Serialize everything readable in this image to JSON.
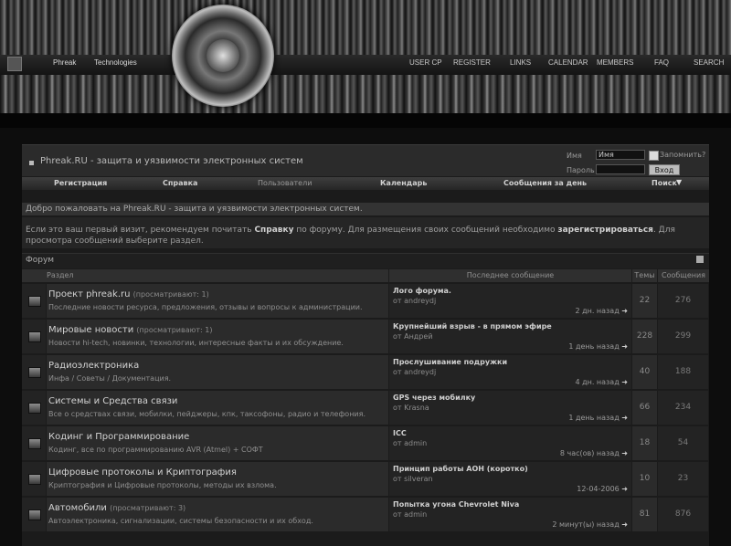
{
  "header": {
    "logo_left": "Phreak",
    "logo_right": "Technologies",
    "nav": [
      "USER CP",
      "REGISTER",
      "LINKS",
      "CALENDAR",
      "MEMBERS",
      "FAQ",
      "SEARCH"
    ]
  },
  "site_title": "Phreak.RU - защита и уязвимости электронных систем",
  "login": {
    "name_label": "Имя",
    "name_value": "Имя",
    "password_label": "Пароль",
    "remember_label": "Запомнить?",
    "submit_label": "Вход"
  },
  "menu": [
    "Регистрация",
    "Справка",
    "Пользователи",
    "Календарь",
    "Сообщения за день",
    "Поиск"
  ],
  "welcome": "Добро пожаловать на Phreak.RU - защита и уязвимости электронных систем.",
  "intro": {
    "part1": "Если это ваш первый визит, рекомендуем почитать ",
    "help_link": "Справку",
    "part2": " по форуму. Для размещения своих сообщений необходимо ",
    "register_link": "зарегистрироваться",
    "part3": ". Для просмотра сообщений выберите раздел."
  },
  "forum_header": "Форум",
  "columns": {
    "section": "Раздел",
    "last_post": "Последнее сообщение",
    "topics": "Темы",
    "posts": "Сообщения"
  },
  "forums": [
    {
      "title": "Проект phreak.ru",
      "viewing": "(просматривают: 1)",
      "desc": "Последние новости ресурса, предложения, отзывы и вопросы к администрации.",
      "last_title": "Лого форума.",
      "last_by": "от andreydj",
      "last_date": "2 дн. назад",
      "topics": "22",
      "posts": "276"
    },
    {
      "title": "Мировые новости",
      "viewing": "(просматривают: 1)",
      "desc": "Новости hi-tech, новинки, технологии, интересные факты и их обсуждение.",
      "last_title": "Крупнейший взрыв - в прямом эфире",
      "last_by": "от Андрей",
      "last_date": "1 день назад",
      "topics": "228",
      "posts": "299"
    },
    {
      "title": "Радиоэлектроника",
      "viewing": "",
      "desc": "Инфа / Советы / Документация.",
      "last_title": "Прослушивание подружки",
      "last_by": "от andreydj",
      "last_date": "4 дн. назад",
      "topics": "40",
      "posts": "188"
    },
    {
      "title": "Системы и Средства связи",
      "viewing": "",
      "desc": "Все о средствах связи, мобилки, пейджеры, кпк, таксофоны, радио и телефония.",
      "last_title": "GPS через мобилку",
      "last_by": "от Krasna",
      "last_date": "1 день назад",
      "topics": "66",
      "posts": "234"
    },
    {
      "title": "Кодинг и Программирование",
      "viewing": "",
      "desc": "Кодинг, все по программированию AVR (Atmel) + СОФТ",
      "last_title": "ICC",
      "last_by": "от admin",
      "last_date": "8 час(ов) назад",
      "topics": "18",
      "posts": "54"
    },
    {
      "title": "Цифровые протоколы и Криптография",
      "viewing": "",
      "desc": "Криптография и Цифровые протоколы, методы их взлома.",
      "last_title": "Принцип работы АОН (коротко)",
      "last_by": "от silveran",
      "last_date": "12-04-2006",
      "topics": "10",
      "posts": "23"
    },
    {
      "title": "Автомобили",
      "viewing": "(просматривают: 3)",
      "desc": "Автоэлектроника, сигнализации, системы безопасности и их обход.",
      "last_title": "Попытка угона Chevrolet Niva",
      "last_by": "от admin",
      "last_date": "2 минут(ы) назад",
      "topics": "81",
      "posts": "876"
    }
  ]
}
